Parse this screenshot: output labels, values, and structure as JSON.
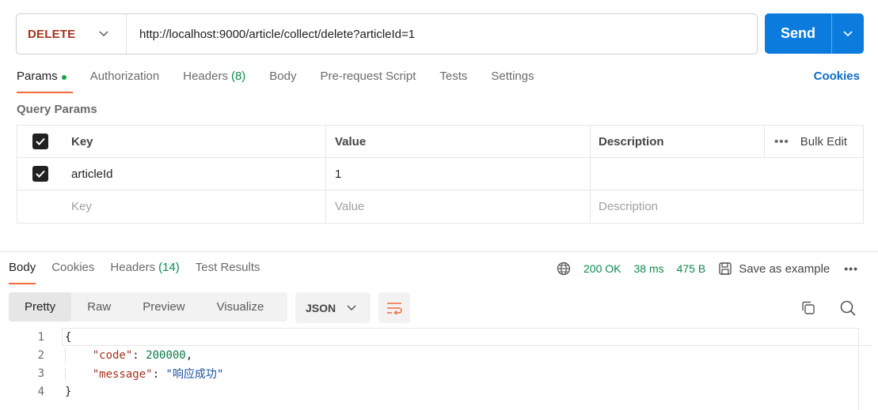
{
  "request": {
    "method": "DELETE",
    "url": "http://localhost:9000/article/collect/delete?articleId=1",
    "send_label": "Send"
  },
  "req_tabs": {
    "params": "Params",
    "authorization": "Authorization",
    "headers": "Headers",
    "headers_count": "(8)",
    "body": "Body",
    "prerequest": "Pre-request Script",
    "tests": "Tests",
    "settings": "Settings",
    "cookies": "Cookies"
  },
  "query_params": {
    "title": "Query Params",
    "columns": {
      "key": "Key",
      "value": "Value",
      "description": "Description",
      "bulk_edit": "Bulk Edit"
    },
    "rows": [
      {
        "checked": true,
        "key": "articleId",
        "value": "1",
        "description": ""
      }
    ],
    "placeholders": {
      "key": "Key",
      "value": "Value",
      "description": "Description"
    }
  },
  "res_tabs": {
    "body": "Body",
    "cookies": "Cookies",
    "headers": "Headers",
    "headers_count": "(14)",
    "test_results": "Test Results"
  },
  "status": {
    "code": "200 OK",
    "time": "38 ms",
    "size": "475 B",
    "save_example": "Save as example",
    "color": "#0a8a4a"
  },
  "formats": {
    "pretty": "Pretty",
    "raw": "Raw",
    "preview": "Preview",
    "visualize": "Visualize",
    "lang": "JSON"
  },
  "code_lines": [
    {
      "n": "1",
      "text": "{"
    },
    {
      "n": "2",
      "key": "\"code\"",
      "sep": ": ",
      "value": "200000",
      "tail": ","
    },
    {
      "n": "3",
      "key": "\"message\"",
      "sep": ": ",
      "value": "\"响应成功\"",
      "tail": ""
    },
    {
      "n": "4",
      "text": "}"
    }
  ],
  "colors": {
    "accent": "#0b7cde",
    "method": "#a6311d",
    "tab_underline": "#f26b3a"
  }
}
